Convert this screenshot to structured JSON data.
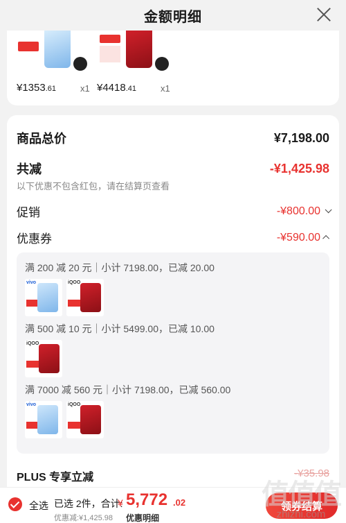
{
  "header": {
    "title": "金额明细",
    "close_icon": "close-icon"
  },
  "products": [
    {
      "price_main": "¥1353",
      "price_cents": ".61",
      "qty": "x1"
    },
    {
      "price_main": "¥4418",
      "price_cents": ".41",
      "qty": "x1"
    }
  ],
  "summary": {
    "total_label": "商品总价",
    "total_value": "¥7,198.00",
    "reduce_label": "共减",
    "reduce_value": "-¥1,425.98",
    "note": "以下优惠不包含红包，请在结算页查看",
    "promo_label": "促销",
    "promo_value": "-¥800.00",
    "coupon_label": "优惠券",
    "coupon_value": "-¥590.00"
  },
  "coupons": [
    {
      "text": "满 200 减 20 元｜小计 7198.00，已减 20.00"
    },
    {
      "text": "满 500 减 10 元｜小计 5499.00，已减 10.00"
    },
    {
      "text": "满 7000 减 560 元｜小计 7198.00，已减 560.00"
    }
  ],
  "plus": {
    "label": "PLUS 专享立减",
    "value": "-¥35.98"
  },
  "bottom": {
    "select_all": "全选",
    "selected": "已选 2件，合计:",
    "currency": "¥",
    "total_main": "5,772",
    "total_cents": ".02",
    "discount": "优惠减:¥1,425.98",
    "detail_link": "优惠明细",
    "checkout": "领券结算"
  },
  "watermark": {
    "logo": "值值值",
    "text": "zhizhi.com"
  },
  "colors": {
    "accent": "#e8322f",
    "background": "#f2f2f2"
  }
}
